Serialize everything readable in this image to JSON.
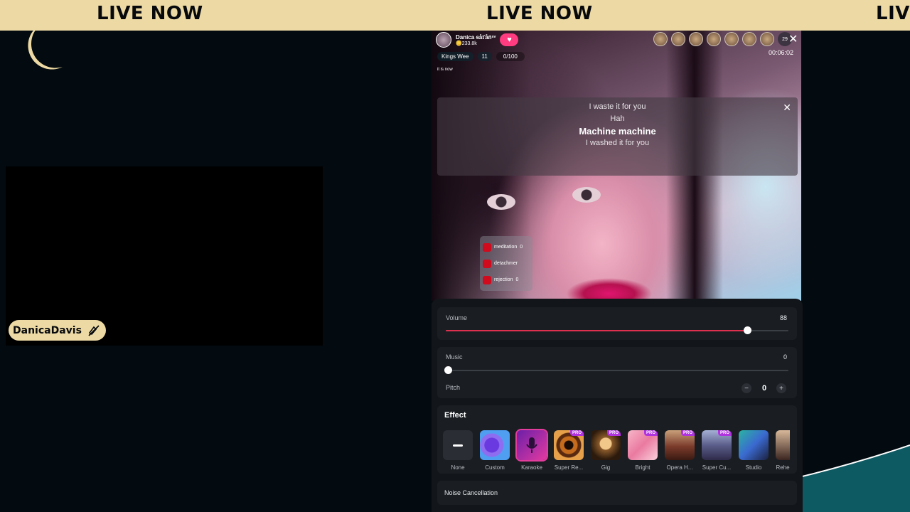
{
  "banner": {
    "items": [
      "LIVE NOW",
      "LIVE NOW",
      "LIVE NOW"
    ]
  },
  "camera": {
    "name": "DanicaDavis"
  },
  "live": {
    "host_name": "Danica",
    "host_tag": "ᵴåťåṅˢᵛ",
    "host_coins": "233.8k",
    "group_pill": "Kings Wee",
    "group_level": "11",
    "progress_text": "0/100",
    "note": "it is now",
    "viewer_count": "29",
    "timer": "00:06:02",
    "lyrics": [
      "I waste it for you",
      "Hah",
      "Machine machine",
      "I washed it for you"
    ],
    "tags": [
      {
        "label": "meditation",
        "count": "0"
      },
      {
        "label": "detachmer",
        "count": ""
      },
      {
        "label": "rejection",
        "count": "0"
      }
    ]
  },
  "audio": {
    "volume_label": "Volume",
    "volume_value": "88",
    "music_label": "Music",
    "music_value": "0",
    "pitch_label": "Pitch",
    "pitch_value": "0",
    "pitch_minus": "−",
    "pitch_plus": "+",
    "effect_title": "Effect",
    "effects": [
      {
        "name": "None",
        "pro": false
      },
      {
        "name": "Custom",
        "pro": false
      },
      {
        "name": "Karaoke",
        "pro": false,
        "selected": true
      },
      {
        "name": "Super Re...",
        "pro": true
      },
      {
        "name": "Gig",
        "pro": true
      },
      {
        "name": "Bright",
        "pro": true
      },
      {
        "name": "Opera H...",
        "pro": true
      },
      {
        "name": "Super Cu...",
        "pro": true
      },
      {
        "name": "Studio",
        "pro": false
      },
      {
        "name": "Rehe",
        "pro": false
      }
    ],
    "pro_badge": "PRO",
    "noise_label": "Noise Cancellation"
  },
  "colors": {
    "banner": "#ecd9a3",
    "accent": "#e0304f",
    "teal": "#0e5a63"
  }
}
